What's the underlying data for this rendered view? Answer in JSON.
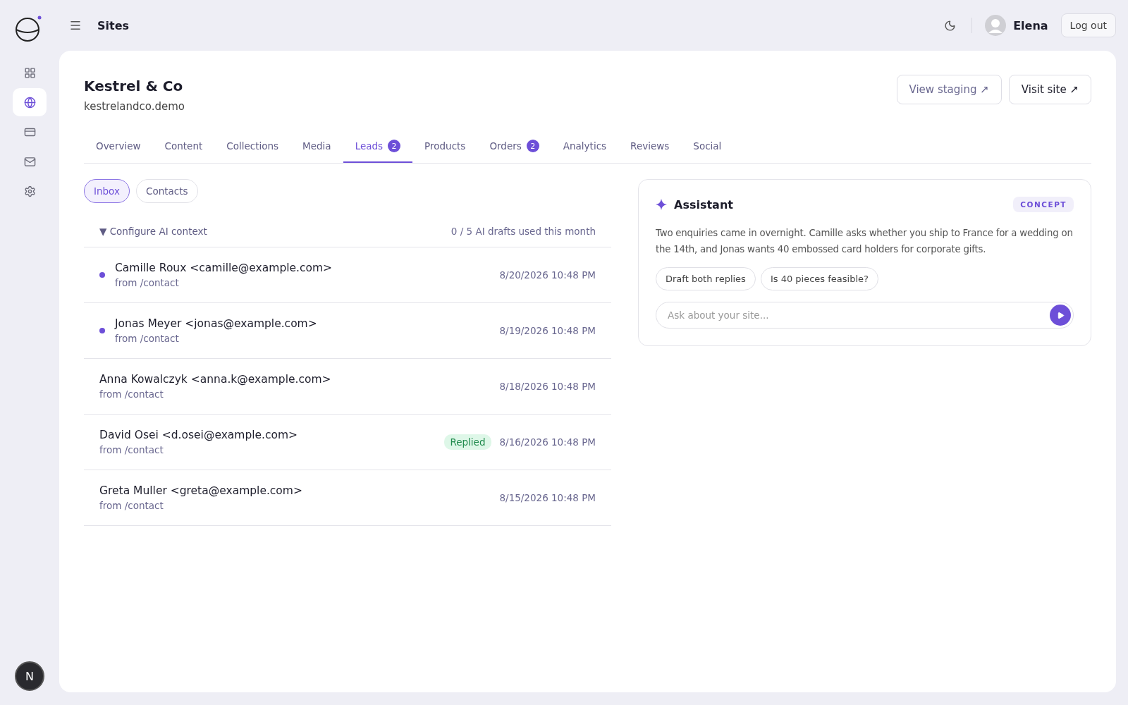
{
  "sidebar": {
    "items": [
      {
        "kind": "grid",
        "selected": false
      },
      {
        "kind": "globe",
        "selected": true
      },
      {
        "kind": "card",
        "selected": false
      },
      {
        "kind": "mail",
        "selected": false
      },
      {
        "kind": "gear",
        "selected": false
      }
    ],
    "account_badge": "N"
  },
  "topbar": {
    "title": "Sites",
    "user": "Elena",
    "logout": "Log out"
  },
  "site": {
    "name": "Kestrel & Co",
    "domain": "kestrelandco.demo"
  },
  "actions": [
    {
      "label": "View staging ↗",
      "kind": "secondary"
    },
    {
      "label": "Visit site ↗",
      "kind": "primary"
    }
  ],
  "tabs": [
    {
      "label": "Overview",
      "selected": false
    },
    {
      "label": "Content",
      "selected": false
    },
    {
      "label": "Collections",
      "selected": false
    },
    {
      "label": "Media",
      "selected": false
    },
    {
      "label": "Leads",
      "count": "2",
      "selected": true
    },
    {
      "label": "Products",
      "selected": false
    },
    {
      "label": "Orders",
      "count": "2",
      "selected": false
    },
    {
      "label": "Analytics",
      "selected": false
    },
    {
      "label": "Reviews",
      "selected": false
    },
    {
      "label": "Social",
      "selected": false
    }
  ],
  "subtabs": [
    {
      "label": "Inbox",
      "selected": true
    },
    {
      "label": "Contacts",
      "selected": false
    }
  ],
  "ai_context": {
    "label": "▼ Configure AI context",
    "usage": "0 / 5 AI drafts used this month"
  },
  "leads": [
    {
      "name": "Camille Roux <camille@example.com>",
      "source": "from /contact",
      "date": "8/20/2026 10:48 PM",
      "unread": true
    },
    {
      "name": "Jonas Meyer <jonas@example.com>",
      "source": "from /contact",
      "date": "8/19/2026 10:48 PM",
      "unread": true
    },
    {
      "name": "Anna Kowalczyk <anna.k@example.com>",
      "source": "from /contact",
      "date": "8/18/2026 10:48 PM",
      "unread": false
    },
    {
      "name": "David Osei <d.osei@example.com>",
      "source": "from /contact",
      "date": "8/16/2026 10:48 PM",
      "unread": false,
      "status": "Replied"
    },
    {
      "name": "Greta Muller <greta@example.com>",
      "source": "from /contact",
      "date": "8/15/2026 10:48 PM",
      "unread": false
    }
  ],
  "assistant": {
    "title": "Assistant",
    "tag": "CONCEPT",
    "message": "Two enquiries came in overnight. Camille asks whether you ship to France for a wedding on the 14th, and Jonas wants 40 embossed card holders for corporate gifts.",
    "suggestions": [
      "Draft both replies",
      "Is 40 pieces feasible?"
    ],
    "input": {
      "placeholder": "Ask about your site..."
    }
  }
}
